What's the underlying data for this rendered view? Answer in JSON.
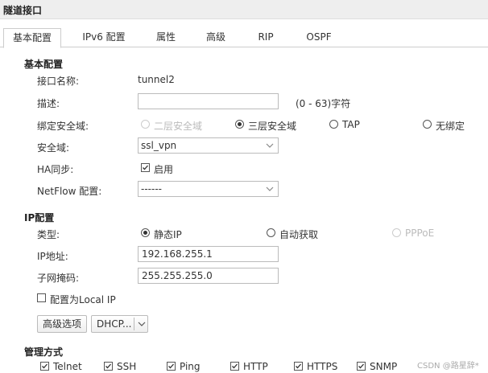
{
  "window": {
    "title": "隧道接口"
  },
  "tabs": [
    {
      "label": "基本配置",
      "active": true
    },
    {
      "label": "IPv6 配置"
    },
    {
      "label": "属性"
    },
    {
      "label": "高级"
    },
    {
      "label": "RIP"
    },
    {
      "label": "OSPF"
    }
  ],
  "basic": {
    "section_title": "基本配置",
    "name_label": "接口名称:",
    "name_value": "tunnel2",
    "desc_label": "描述:",
    "desc_value": "",
    "desc_hint": "(0 - 63)字符",
    "bind_label": "绑定安全域:",
    "bind_options": [
      "二层安全域",
      "三层安全域",
      "TAP",
      "无绑定"
    ],
    "bind_selected": "三层安全域",
    "zone_label": "安全域:",
    "zone_value": "ssl_vpn",
    "ha_label": "HA同步:",
    "ha_option": "启用",
    "ha_checked": true,
    "netflow_label": "NetFlow 配置:",
    "netflow_value": "------"
  },
  "ip": {
    "section_title": "IP配置",
    "type_label": "类型:",
    "type_options": [
      "静态IP",
      "自动获取",
      "PPPoE"
    ],
    "type_selected": "静态IP",
    "addr_label": "IP地址:",
    "addr_value": "192.168.255.1",
    "mask_label": "子网掩码:",
    "mask_value": "255.255.255.0",
    "local_ip_label": "配置为Local IP",
    "local_ip_checked": false,
    "advanced_button": "高级选项",
    "dhcp_button": "DHCP..."
  },
  "mgmt": {
    "section_title": "管理方式",
    "options": [
      {
        "label": "Telnet",
        "checked": true
      },
      {
        "label": "SSH",
        "checked": true
      },
      {
        "label": "Ping",
        "checked": true
      },
      {
        "label": "HTTP",
        "checked": true
      },
      {
        "label": "HTTPS",
        "checked": true
      },
      {
        "label": "SNMP",
        "checked": true
      }
    ]
  },
  "watermark": "CSDN @路星辞*",
  "colors": {
    "title_bg": "#eeeeee",
    "border": "#cccccc",
    "disabled": "#bbbbbb"
  }
}
